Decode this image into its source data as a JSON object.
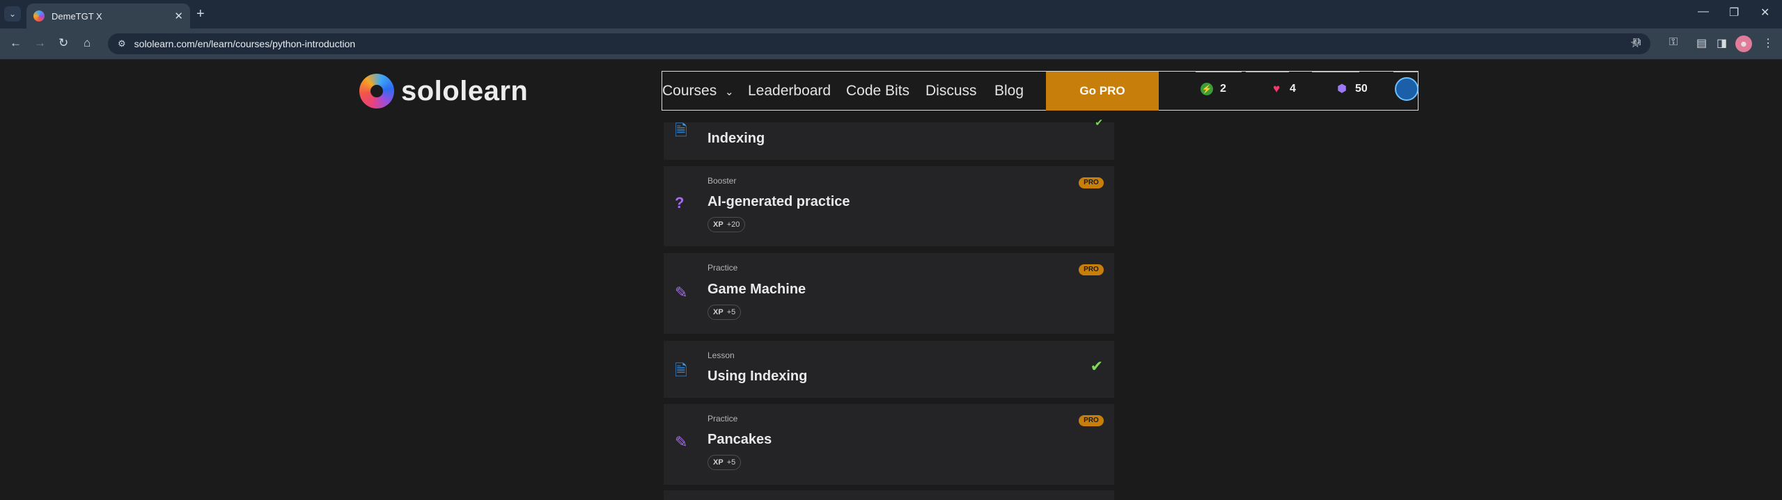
{
  "browser": {
    "tab_title": "DemeTGT X",
    "new_tab": "+",
    "url": "sololearn.com/en/learn/courses/python-introduction"
  },
  "header": {
    "logo_text": "sololearn",
    "nav": {
      "courses": "Courses",
      "leaderboard": "Leaderboard",
      "code_bits": "Code Bits",
      "discuss": "Discuss",
      "blog": "Blog",
      "go_pro": "Go PRO"
    },
    "stats": {
      "streak": "2",
      "hearts": "4",
      "gems": "50"
    }
  },
  "cards": [
    {
      "type": "",
      "title": "Indexing",
      "icon": "lesson-icon",
      "completed": true
    },
    {
      "type": "Booster",
      "title": "AI-generated practice",
      "icon": "question-icon",
      "xp_label": "XP",
      "xp_value": "+20",
      "pro": "PRO"
    },
    {
      "type": "Practice",
      "title": "Game Machine",
      "icon": "practice-pencil-icon",
      "xp_label": "XP",
      "xp_value": "+5",
      "pro": "PRO"
    },
    {
      "type": "Lesson",
      "title": "Using Indexing",
      "icon": "lesson-icon",
      "completed": true
    },
    {
      "type": "Practice",
      "title": "Pancakes",
      "icon": "practice-pencil-icon",
      "xp_label": "XP",
      "xp_value": "+5",
      "pro": "PRO"
    }
  ],
  "colors": {
    "accent_pro": "#c77e0b",
    "check_green": "#7ed957",
    "lesson_blue": "#3d9cf0",
    "practice_purple": "#a66bf0"
  }
}
